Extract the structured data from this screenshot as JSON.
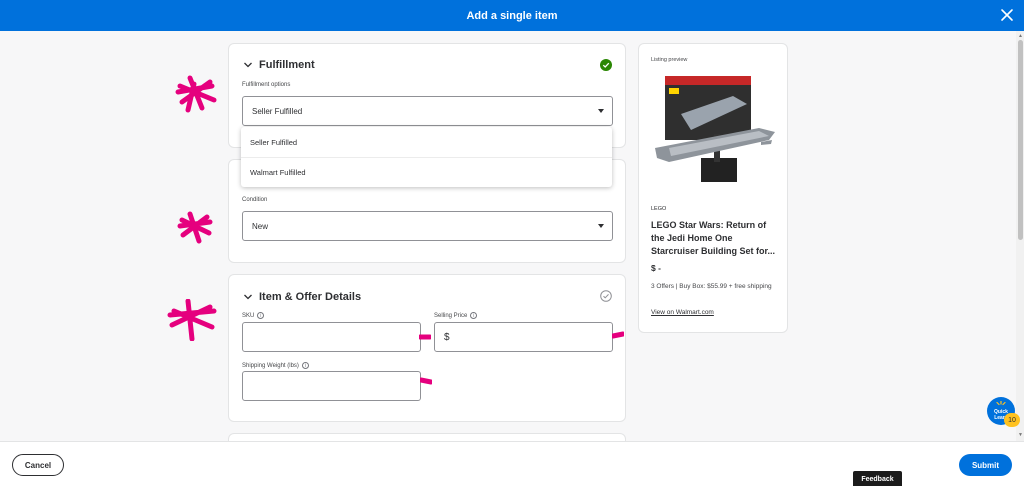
{
  "header": {
    "title": "Add a single item",
    "close_icon": "close-icon"
  },
  "fulfillment": {
    "title": "Fulfillment",
    "options_label": "Fulfillment options",
    "selected": "Seller Fulfilled",
    "dropdown_options": [
      "Seller Fulfilled",
      "Walmart Fulfilled"
    ],
    "status": "complete"
  },
  "condition": {
    "label": "Condition",
    "selected": "New"
  },
  "item_offer": {
    "title": "Item & Offer Details",
    "sku_label": "SKU",
    "sku_value": "",
    "price_label": "Selling Price",
    "price_prefix": "$",
    "price_value": "",
    "weight_label": "Shipping Weight (lbs)",
    "weight_value": "",
    "status": "pending"
  },
  "preview": {
    "label": "Listing preview",
    "brand": "LEGO",
    "name": "LEGO Star Wars: Return of the Jedi Home One Starcruiser Building Set for...",
    "price": "$ -",
    "offers": "3 Offers | Buy Box: $55.99 + free shipping",
    "link": "View on Walmart.com"
  },
  "footer": {
    "cancel": "Cancel",
    "submit": "Submit",
    "feedback": "Feedback"
  },
  "quick_learn": {
    "line1": "Quick",
    "line2": "Learn",
    "count": "10"
  },
  "colors": {
    "brand_blue": "#0071dc",
    "success_green": "#2a8703",
    "annotation_pink": "#e5007e",
    "badge_yellow": "#ffc220"
  }
}
